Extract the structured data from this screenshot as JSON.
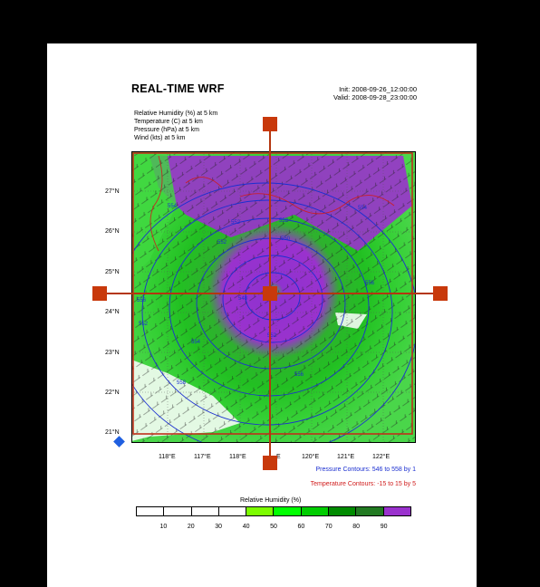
{
  "header": {
    "title": "REAL-TIME WRF",
    "init": "Init: 2008-09-26_12:00:00",
    "valid": "Valid: 2008-09-28_23:00:00"
  },
  "fields": [
    "Relative Humidity   (%)     at   5 km",
    "Temperature   (C)       at   5 km",
    "Pressure    (hPa)     at   5 km",
    "Wind    (kts)      at   5 km"
  ],
  "map": {
    "lat_labels": [
      "27°N",
      "26°N",
      "25°N",
      "24°N",
      "23°N",
      "22°N",
      "21°N"
    ],
    "lon_labels": [
      "118°E",
      "117°E",
      "118°E",
      "E",
      "120°E",
      "121°E",
      "122°E"
    ],
    "contour_labels": [
      "554",
      "552",
      "552",
      "554",
      "552",
      "550",
      "548",
      "556",
      "556",
      "554",
      "552",
      "558",
      "556",
      "552"
    ]
  },
  "legend": {
    "pressure_contours": "Pressure Contours: 546 to 558 by 1",
    "temperature_contours": "Temperature Contours: -15 to 15 by 5",
    "colorbar_title": "Relative Humidity  (%)",
    "colorbar_ticks": [
      "10",
      "20",
      "30",
      "40",
      "50",
      "60",
      "70",
      "80",
      "90"
    ],
    "colorbar_colors": [
      "#ffffff",
      "#ffffff",
      "#ffffff",
      "#ffffff",
      "#7cfc00",
      "#00ff00",
      "#00cd00",
      "#008b00",
      "#227a22",
      "#9a32cd"
    ]
  },
  "colors": {
    "crosshair": "#b4360f",
    "handle": "#c8390b",
    "pressure_contour": "#1b2fd0",
    "temperature_contour": "#d01b1b",
    "anchor": "#1f5fe0"
  }
}
